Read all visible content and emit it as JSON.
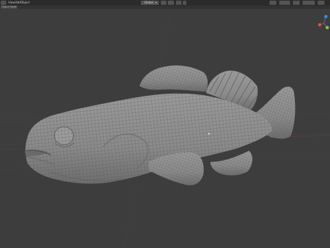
{
  "header": {
    "menus": [
      {
        "label": "View"
      },
      {
        "label": "Add"
      },
      {
        "label": "Object"
      }
    ],
    "transform_orientation": "Global"
  },
  "sub_header": {
    "mode_label": "Object Mode"
  },
  "viewport": {
    "background_color": "#3d3d3d",
    "model_color": "#8c8c8c",
    "wire_color": "#505050"
  },
  "gizmo": {
    "x_color": "#d9534f",
    "y_color": "#8bc34a",
    "z_color": "#3b8fd9"
  }
}
